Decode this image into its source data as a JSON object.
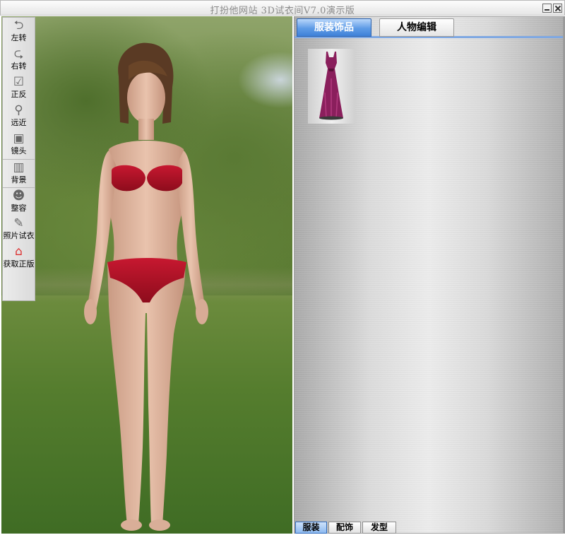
{
  "window": {
    "title": "打扮他网站 3D试衣间V7.0演示版"
  },
  "toolbar": {
    "items": [
      {
        "label": "左转",
        "icon": "rotate-left-arrow-icon"
      },
      {
        "label": "右转",
        "icon": "rotate-right-arrow-icon"
      },
      {
        "label": "正反",
        "icon": "checkbox-flip-icon"
      },
      {
        "label": "远近",
        "icon": "magnifier-zoom-icon"
      },
      {
        "label": "镜头",
        "icon": "camera-lens-icon"
      },
      {
        "label": "背景",
        "icon": "background-image-icon"
      },
      {
        "label": "整容",
        "icon": "face-avatar-icon"
      },
      {
        "label": "照片试衣",
        "icon": "photo-film-icon"
      },
      {
        "label": "获取正版",
        "icon": "home-house-icon"
      }
    ]
  },
  "panel": {
    "tabs": [
      {
        "label": "服装饰品",
        "active": true
      },
      {
        "label": "人物编辑",
        "active": false
      }
    ],
    "items": [
      {
        "icon": "purple-long-dress-thumbnail"
      }
    ],
    "bottom_tabs": [
      {
        "label": "服装",
        "active": true
      },
      {
        "label": "配饰",
        "active": false
      },
      {
        "label": "发型",
        "active": false
      }
    ]
  },
  "colors": {
    "active_tab": "#4a8ae0",
    "tab_underline": "#7fa8e2",
    "dress": "#8a1f5c",
    "bikini": "#b3132a"
  }
}
